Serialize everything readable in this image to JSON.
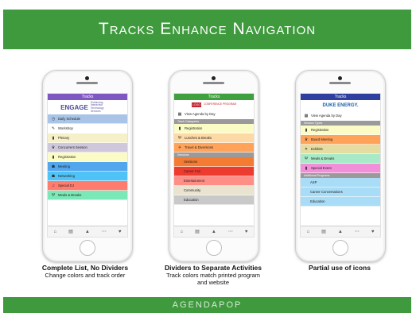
{
  "title": "Tracks Enhance Navigation",
  "footer": "AGENDAPOP",
  "tab_icons": [
    "home-icon",
    "document-icon",
    "map-icon",
    "more-icon",
    "heart-icon"
  ],
  "phones": [
    {
      "appbar": {
        "title": "Tracks",
        "color": "#7e57c2"
      },
      "logo": {
        "main": "ENGAGE",
        "sub": "Enhancing Interactive Technology Services"
      },
      "rows": [
        {
          "label": "Daily Schedule",
          "color": "#a8c4e6",
          "icon": "calendar-icon",
          "glyph": "◷"
        },
        {
          "label": "Workshop",
          "color": "#ffffff",
          "icon": "wrench-icon",
          "glyph": "✎"
        },
        {
          "label": "Plenary",
          "color": "#f5f0c8",
          "icon": "podium-icon",
          "glyph": "▮"
        },
        {
          "label": "Concurrent Session",
          "color": "#cfc8dd",
          "icon": "trophy-icon",
          "glyph": "♛"
        },
        {
          "label": "Registration",
          "color": "#fbfbc6",
          "icon": "flag-icon",
          "glyph": "▮"
        },
        {
          "label": "Meeting",
          "color": "#52a6ee",
          "icon": "users-icon",
          "glyph": "☗"
        },
        {
          "label": "Networking",
          "color": "#4fc3f7",
          "icon": "network-icon",
          "glyph": "☗"
        },
        {
          "label": "Special DJ",
          "color": "#ff7c6e",
          "icon": "music-icon",
          "glyph": "♫"
        },
        {
          "label": "Meals & Breaks",
          "color": "#7be8b8",
          "icon": "utensils-icon",
          "glyph": "Ψ"
        }
      ]
    },
    {
      "appbar": {
        "title": "Tracks",
        "color": "#3fa03f"
      },
      "logo": {
        "main": "LOGO",
        "sub": "CONFERENCE PROGRAM"
      },
      "rows": [
        {
          "kind": "row",
          "label": "View Agenda by Day",
          "color": "#ffffff",
          "icon": "calendar-icon",
          "glyph": "▦"
        },
        {
          "kind": "divider",
          "label": "Track Categories"
        },
        {
          "kind": "row",
          "label": "Registration",
          "color": "#fbfbc6",
          "icon": "flag-icon",
          "glyph": "▮"
        },
        {
          "kind": "row",
          "label": "Lunches & Breaks",
          "color": "#fdd9a6",
          "icon": "utensils-icon",
          "glyph": "Ψ"
        },
        {
          "kind": "row",
          "label": "Travel & Diversions",
          "color": "#ffa35a",
          "icon": "plane-icon",
          "glyph": "✈"
        },
        {
          "kind": "divider",
          "label": "Sessions"
        },
        {
          "kind": "row",
          "label": "Sessions",
          "color": "#f47b32",
          "icon": "",
          "glyph": ""
        },
        {
          "kind": "row",
          "label": "Career Fair",
          "color": "#ee3b2f",
          "icon": "",
          "glyph": ""
        },
        {
          "kind": "row",
          "label": "Entertainment",
          "color": "#ff8e86",
          "icon": "",
          "glyph": ""
        },
        {
          "kind": "row",
          "label": "Community",
          "color": "#e9e3cf",
          "icon": "",
          "glyph": ""
        },
        {
          "kind": "row",
          "label": "Education",
          "color": "#c9c9c9",
          "icon": "",
          "glyph": ""
        }
      ]
    },
    {
      "appbar": {
        "title": "Tracks",
        "color": "#2f3f9f"
      },
      "logo": {
        "main": "DUKE ENERGY.",
        "sub": ""
      },
      "rows": [
        {
          "kind": "row",
          "label": "View Agenda by Day",
          "color": "#ffffff",
          "icon": "calendar-icon",
          "glyph": "▦"
        },
        {
          "kind": "divider",
          "label": "Session Types"
        },
        {
          "kind": "row",
          "label": "Registration",
          "color": "#fbfbc6",
          "icon": "flag-icon",
          "glyph": "▮"
        },
        {
          "kind": "row",
          "label": "Board Meeting",
          "color": "#ffa35a",
          "icon": "trophy-icon",
          "glyph": "♛"
        },
        {
          "kind": "row",
          "label": "Exhibits",
          "color": "#e4dca0",
          "icon": "star-icon",
          "glyph": "✦"
        },
        {
          "kind": "row",
          "label": "Meals & Breaks",
          "color": "#a8eac8",
          "icon": "utensils-icon",
          "glyph": "Ψ"
        },
        {
          "kind": "row",
          "label": "Special Event",
          "color": "#f18fd8",
          "icon": "flag-icon",
          "glyph": "▮"
        },
        {
          "kind": "divider",
          "label": "Additional Programs"
        },
        {
          "kind": "row",
          "label": "ASP",
          "color": "#a9dcf6",
          "icon": "",
          "glyph": ""
        },
        {
          "kind": "row",
          "label": "Career Conversations",
          "color": "#a9dcf6",
          "icon": "",
          "glyph": ""
        },
        {
          "kind": "row",
          "label": "Education",
          "color": "#a9dcf6",
          "icon": "",
          "glyph": ""
        }
      ]
    }
  ],
  "captions": [
    {
      "title": "Complete List, No Dividers",
      "sub": [
        "Change colors and track order"
      ]
    },
    {
      "title": "Dividers to Separate Activities",
      "sub": [
        "Track colors match printed program",
        "and website"
      ]
    },
    {
      "title": "Partial use of icons",
      "sub": []
    }
  ]
}
